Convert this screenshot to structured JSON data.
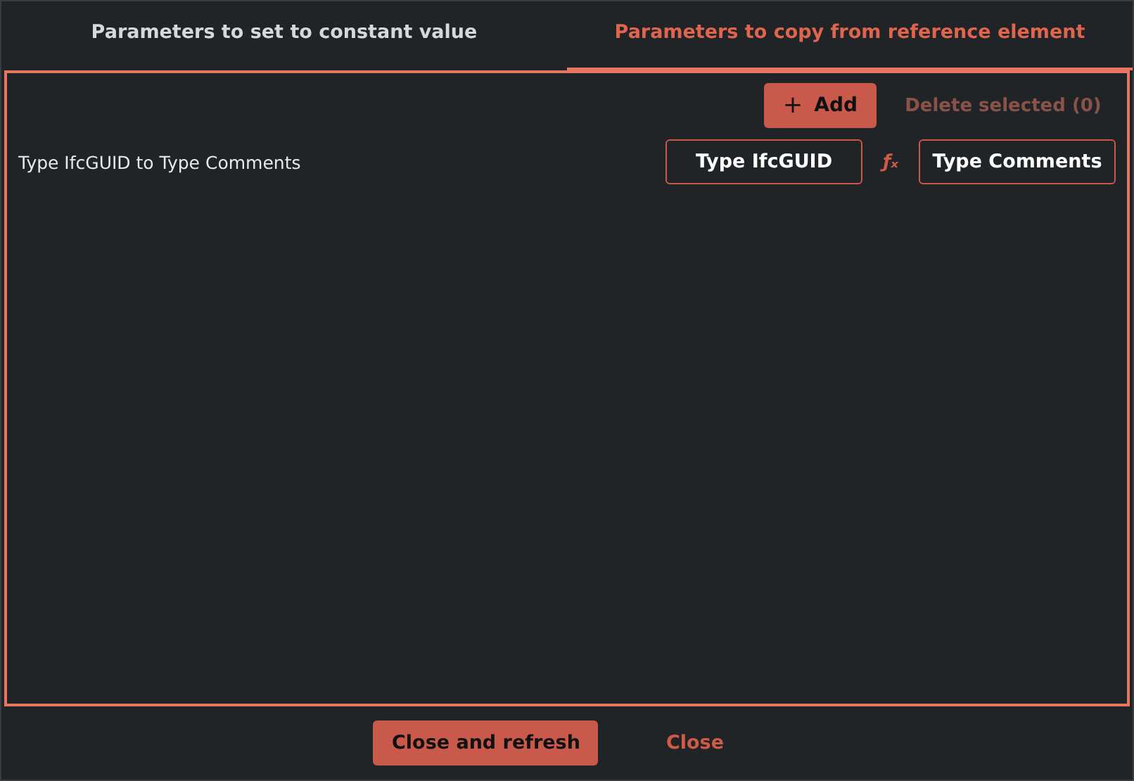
{
  "tabs": [
    {
      "label": "Parameters to set to constant value",
      "selected": false
    },
    {
      "label": "Parameters to copy from reference element",
      "selected": true
    }
  ],
  "toolbar": {
    "add_button": {
      "icon": "+",
      "label": "Add"
    },
    "delete_button": {
      "label": "Delete selected (0)",
      "disabled": true
    }
  },
  "mappings": [
    {
      "label": "Type IfcGUID to Type Comments",
      "source": "Type IfcGUID",
      "operator": "ƒₓ",
      "target": "Type Comments"
    }
  ],
  "footer": {
    "buttons": [
      {
        "label": "Close and refresh",
        "kind": "primary"
      },
      {
        "label": "Close",
        "kind": "link"
      }
    ]
  }
}
